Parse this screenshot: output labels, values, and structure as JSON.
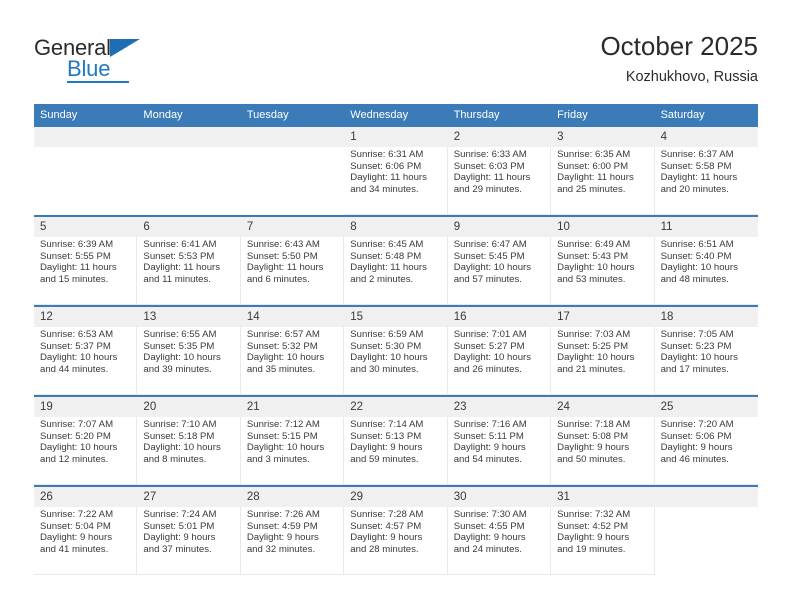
{
  "brand": {
    "name_top": "General",
    "name_bottom": "Blue",
    "accent_color": "#1f7ac0",
    "triangle_icon": "triangle-icon"
  },
  "header": {
    "title": "October 2025",
    "location": "Kozhukhovo, Russia"
  },
  "theme": {
    "header_blue": "#3b7cb8",
    "daynum_band": "#f0f0f0",
    "cell_background": "#ffffff",
    "text_color": "#3a3a3a"
  },
  "weekdays": [
    "Sunday",
    "Monday",
    "Tuesday",
    "Wednesday",
    "Thursday",
    "Friday",
    "Saturday"
  ],
  "weeks": [
    {
      "days": [
        {
          "day": "",
          "empty": true
        },
        {
          "day": "",
          "empty": true
        },
        {
          "day": "",
          "empty": true
        },
        {
          "day": "1",
          "sunrise": "Sunrise: 6:31 AM",
          "sunset": "Sunset: 6:06 PM",
          "daylight1": "Daylight: 11 hours",
          "daylight2": "and 34 minutes."
        },
        {
          "day": "2",
          "sunrise": "Sunrise: 6:33 AM",
          "sunset": "Sunset: 6:03 PM",
          "daylight1": "Daylight: 11 hours",
          "daylight2": "and 29 minutes."
        },
        {
          "day": "3",
          "sunrise": "Sunrise: 6:35 AM",
          "sunset": "Sunset: 6:00 PM",
          "daylight1": "Daylight: 11 hours",
          "daylight2": "and 25 minutes."
        },
        {
          "day": "4",
          "sunrise": "Sunrise: 6:37 AM",
          "sunset": "Sunset: 5:58 PM",
          "daylight1": "Daylight: 11 hours",
          "daylight2": "and 20 minutes."
        }
      ]
    },
    {
      "days": [
        {
          "day": "5",
          "sunrise": "Sunrise: 6:39 AM",
          "sunset": "Sunset: 5:55 PM",
          "daylight1": "Daylight: 11 hours",
          "daylight2": "and 15 minutes."
        },
        {
          "day": "6",
          "sunrise": "Sunrise: 6:41 AM",
          "sunset": "Sunset: 5:53 PM",
          "daylight1": "Daylight: 11 hours",
          "daylight2": "and 11 minutes."
        },
        {
          "day": "7",
          "sunrise": "Sunrise: 6:43 AM",
          "sunset": "Sunset: 5:50 PM",
          "daylight1": "Daylight: 11 hours",
          "daylight2": "and 6 minutes."
        },
        {
          "day": "8",
          "sunrise": "Sunrise: 6:45 AM",
          "sunset": "Sunset: 5:48 PM",
          "daylight1": "Daylight: 11 hours",
          "daylight2": "and 2 minutes."
        },
        {
          "day": "9",
          "sunrise": "Sunrise: 6:47 AM",
          "sunset": "Sunset: 5:45 PM",
          "daylight1": "Daylight: 10 hours",
          "daylight2": "and 57 minutes."
        },
        {
          "day": "10",
          "sunrise": "Sunrise: 6:49 AM",
          "sunset": "Sunset: 5:43 PM",
          "daylight1": "Daylight: 10 hours",
          "daylight2": "and 53 minutes."
        },
        {
          "day": "11",
          "sunrise": "Sunrise: 6:51 AM",
          "sunset": "Sunset: 5:40 PM",
          "daylight1": "Daylight: 10 hours",
          "daylight2": "and 48 minutes."
        }
      ]
    },
    {
      "days": [
        {
          "day": "12",
          "sunrise": "Sunrise: 6:53 AM",
          "sunset": "Sunset: 5:37 PM",
          "daylight1": "Daylight: 10 hours",
          "daylight2": "and 44 minutes."
        },
        {
          "day": "13",
          "sunrise": "Sunrise: 6:55 AM",
          "sunset": "Sunset: 5:35 PM",
          "daylight1": "Daylight: 10 hours",
          "daylight2": "and 39 minutes."
        },
        {
          "day": "14",
          "sunrise": "Sunrise: 6:57 AM",
          "sunset": "Sunset: 5:32 PM",
          "daylight1": "Daylight: 10 hours",
          "daylight2": "and 35 minutes."
        },
        {
          "day": "15",
          "sunrise": "Sunrise: 6:59 AM",
          "sunset": "Sunset: 5:30 PM",
          "daylight1": "Daylight: 10 hours",
          "daylight2": "and 30 minutes."
        },
        {
          "day": "16",
          "sunrise": "Sunrise: 7:01 AM",
          "sunset": "Sunset: 5:27 PM",
          "daylight1": "Daylight: 10 hours",
          "daylight2": "and 26 minutes."
        },
        {
          "day": "17",
          "sunrise": "Sunrise: 7:03 AM",
          "sunset": "Sunset: 5:25 PM",
          "daylight1": "Daylight: 10 hours",
          "daylight2": "and 21 minutes."
        },
        {
          "day": "18",
          "sunrise": "Sunrise: 7:05 AM",
          "sunset": "Sunset: 5:23 PM",
          "daylight1": "Daylight: 10 hours",
          "daylight2": "and 17 minutes."
        }
      ]
    },
    {
      "days": [
        {
          "day": "19",
          "sunrise": "Sunrise: 7:07 AM",
          "sunset": "Sunset: 5:20 PM",
          "daylight1": "Daylight: 10 hours",
          "daylight2": "and 12 minutes."
        },
        {
          "day": "20",
          "sunrise": "Sunrise: 7:10 AM",
          "sunset": "Sunset: 5:18 PM",
          "daylight1": "Daylight: 10 hours",
          "daylight2": "and 8 minutes."
        },
        {
          "day": "21",
          "sunrise": "Sunrise: 7:12 AM",
          "sunset": "Sunset: 5:15 PM",
          "daylight1": "Daylight: 10 hours",
          "daylight2": "and 3 minutes."
        },
        {
          "day": "22",
          "sunrise": "Sunrise: 7:14 AM",
          "sunset": "Sunset: 5:13 PM",
          "daylight1": "Daylight: 9 hours",
          "daylight2": "and 59 minutes."
        },
        {
          "day": "23",
          "sunrise": "Sunrise: 7:16 AM",
          "sunset": "Sunset: 5:11 PM",
          "daylight1": "Daylight: 9 hours",
          "daylight2": "and 54 minutes."
        },
        {
          "day": "24",
          "sunrise": "Sunrise: 7:18 AM",
          "sunset": "Sunset: 5:08 PM",
          "daylight1": "Daylight: 9 hours",
          "daylight2": "and 50 minutes."
        },
        {
          "day": "25",
          "sunrise": "Sunrise: 7:20 AM",
          "sunset": "Sunset: 5:06 PM",
          "daylight1": "Daylight: 9 hours",
          "daylight2": "and 46 minutes."
        }
      ]
    },
    {
      "days": [
        {
          "day": "26",
          "sunrise": "Sunrise: 7:22 AM",
          "sunset": "Sunset: 5:04 PM",
          "daylight1": "Daylight: 9 hours",
          "daylight2": "and 41 minutes."
        },
        {
          "day": "27",
          "sunrise": "Sunrise: 7:24 AM",
          "sunset": "Sunset: 5:01 PM",
          "daylight1": "Daylight: 9 hours",
          "daylight2": "and 37 minutes."
        },
        {
          "day": "28",
          "sunrise": "Sunrise: 7:26 AM",
          "sunset": "Sunset: 4:59 PM",
          "daylight1": "Daylight: 9 hours",
          "daylight2": "and 32 minutes."
        },
        {
          "day": "29",
          "sunrise": "Sunrise: 7:28 AM",
          "sunset": "Sunset: 4:57 PM",
          "daylight1": "Daylight: 9 hours",
          "daylight2": "and 28 minutes."
        },
        {
          "day": "30",
          "sunrise": "Sunrise: 7:30 AM",
          "sunset": "Sunset: 4:55 PM",
          "daylight1": "Daylight: 9 hours",
          "daylight2": "and 24 minutes."
        },
        {
          "day": "31",
          "sunrise": "Sunrise: 7:32 AM",
          "sunset": "Sunset: 4:52 PM",
          "daylight1": "Daylight: 9 hours",
          "daylight2": "and 19 minutes."
        },
        {
          "day": "",
          "empty": true
        }
      ]
    }
  ]
}
